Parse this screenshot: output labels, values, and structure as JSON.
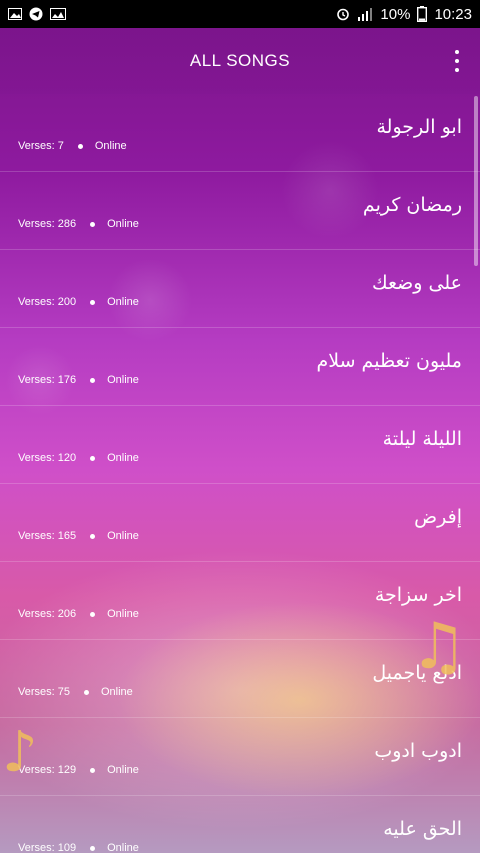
{
  "status_bar": {
    "battery": "10%",
    "time": "10:23"
  },
  "app_bar": {
    "title": "ALL SONGS"
  },
  "songs": [
    {
      "title": "ابو الرجولة",
      "verses": "Verses: 7",
      "status": "Online"
    },
    {
      "title": "رمضان كريم",
      "verses": "Verses: 286",
      "status": "Online"
    },
    {
      "title": "على وضعك",
      "verses": "Verses: 200",
      "status": "Online"
    },
    {
      "title": "مليون تعظيم سلام",
      "verses": "Verses: 176",
      "status": "Online"
    },
    {
      "title": "الليلة ليلتة",
      "verses": "Verses: 120",
      "status": "Online"
    },
    {
      "title": "إفرض",
      "verses": "Verses: 165",
      "status": "Online"
    },
    {
      "title": "اخر سزاجة",
      "verses": "Verses: 206",
      "status": "Online"
    },
    {
      "title": "ادلع ياجميل",
      "verses": "Verses: 75",
      "status": "Online"
    },
    {
      "title": "ادوب ادوب",
      "verses": "Verses: 129",
      "status": "Online"
    },
    {
      "title": "الحق عليه",
      "verses": "Verses: 109",
      "status": "Online"
    }
  ],
  "icons": {
    "status_left": [
      "image-icon",
      "telegram-icon",
      "photo-icon"
    ],
    "status_right": [
      "alarm-icon",
      "signal-icon",
      "battery-icon"
    ],
    "menu": "overflow-menu-icon"
  },
  "colors": {
    "status_bar": "#000000",
    "accent": "#8e1a9f"
  }
}
